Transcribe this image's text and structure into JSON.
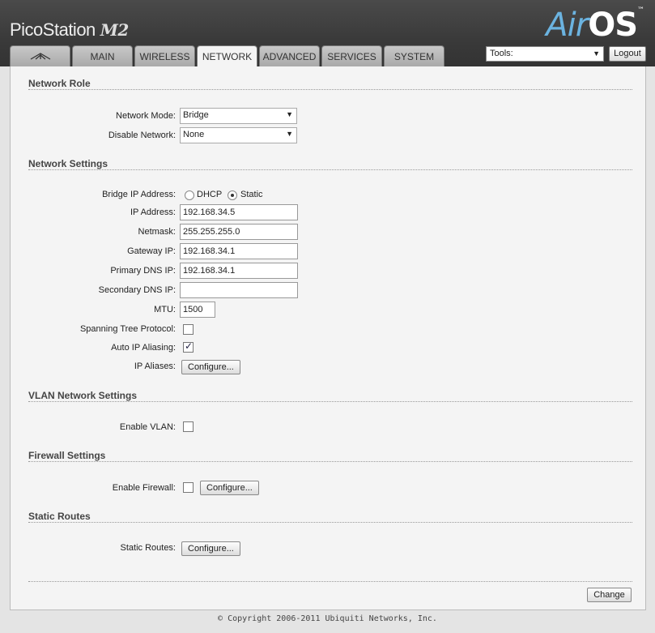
{
  "header": {
    "brand_name": "PicoStation",
    "brand_model": "M2",
    "logo_air": "Air",
    "logo_os": "OS",
    "logo_tm": "™"
  },
  "tabs": [
    {
      "label": "",
      "icon": "ubiquiti-logo-icon"
    },
    {
      "label": "MAIN"
    },
    {
      "label": "WIRELESS"
    },
    {
      "label": "NETWORK"
    },
    {
      "label": "ADVANCED"
    },
    {
      "label": "SERVICES"
    },
    {
      "label": "SYSTEM"
    }
  ],
  "active_tab": "NETWORK",
  "tools": {
    "label": "Tools:",
    "logout_label": "Logout"
  },
  "network_role": {
    "title": "Network Role",
    "network_mode_label": "Network Mode:",
    "network_mode_value": "Bridge",
    "disable_network_label": "Disable Network:",
    "disable_network_value": "None"
  },
  "network_settings": {
    "title": "Network Settings",
    "bridge_ip_label": "Bridge IP Address:",
    "dhcp_label": "DHCP",
    "static_label": "Static",
    "selected_mode": "Static",
    "ip_label": "IP Address:",
    "ip_value": "192.168.34.5",
    "netmask_label": "Netmask:",
    "netmask_value": "255.255.255.0",
    "gateway_label": "Gateway IP:",
    "gateway_value": "192.168.34.1",
    "primary_dns_label": "Primary DNS IP:",
    "primary_dns_value": "192.168.34.1",
    "secondary_dns_label": "Secondary DNS IP:",
    "secondary_dns_value": "",
    "mtu_label": "MTU:",
    "mtu_value": "1500",
    "stp_label": "Spanning Tree Protocol:",
    "stp_checked": false,
    "auto_alias_label": "Auto IP Aliasing:",
    "auto_alias_checked": true,
    "ip_aliases_label": "IP Aliases:",
    "configure_label": "Configure..."
  },
  "vlan": {
    "title": "VLAN Network Settings",
    "enable_label": "Enable VLAN:",
    "enabled": false
  },
  "firewall": {
    "title": "Firewall Settings",
    "enable_label": "Enable Firewall:",
    "enabled": false,
    "configure_label": "Configure..."
  },
  "static_routes": {
    "title": "Static Routes",
    "label": "Static Routes:",
    "configure_label": "Configure..."
  },
  "change_label": "Change",
  "footer": "© Copyright 2006-2011 Ubiquiti Networks, Inc."
}
